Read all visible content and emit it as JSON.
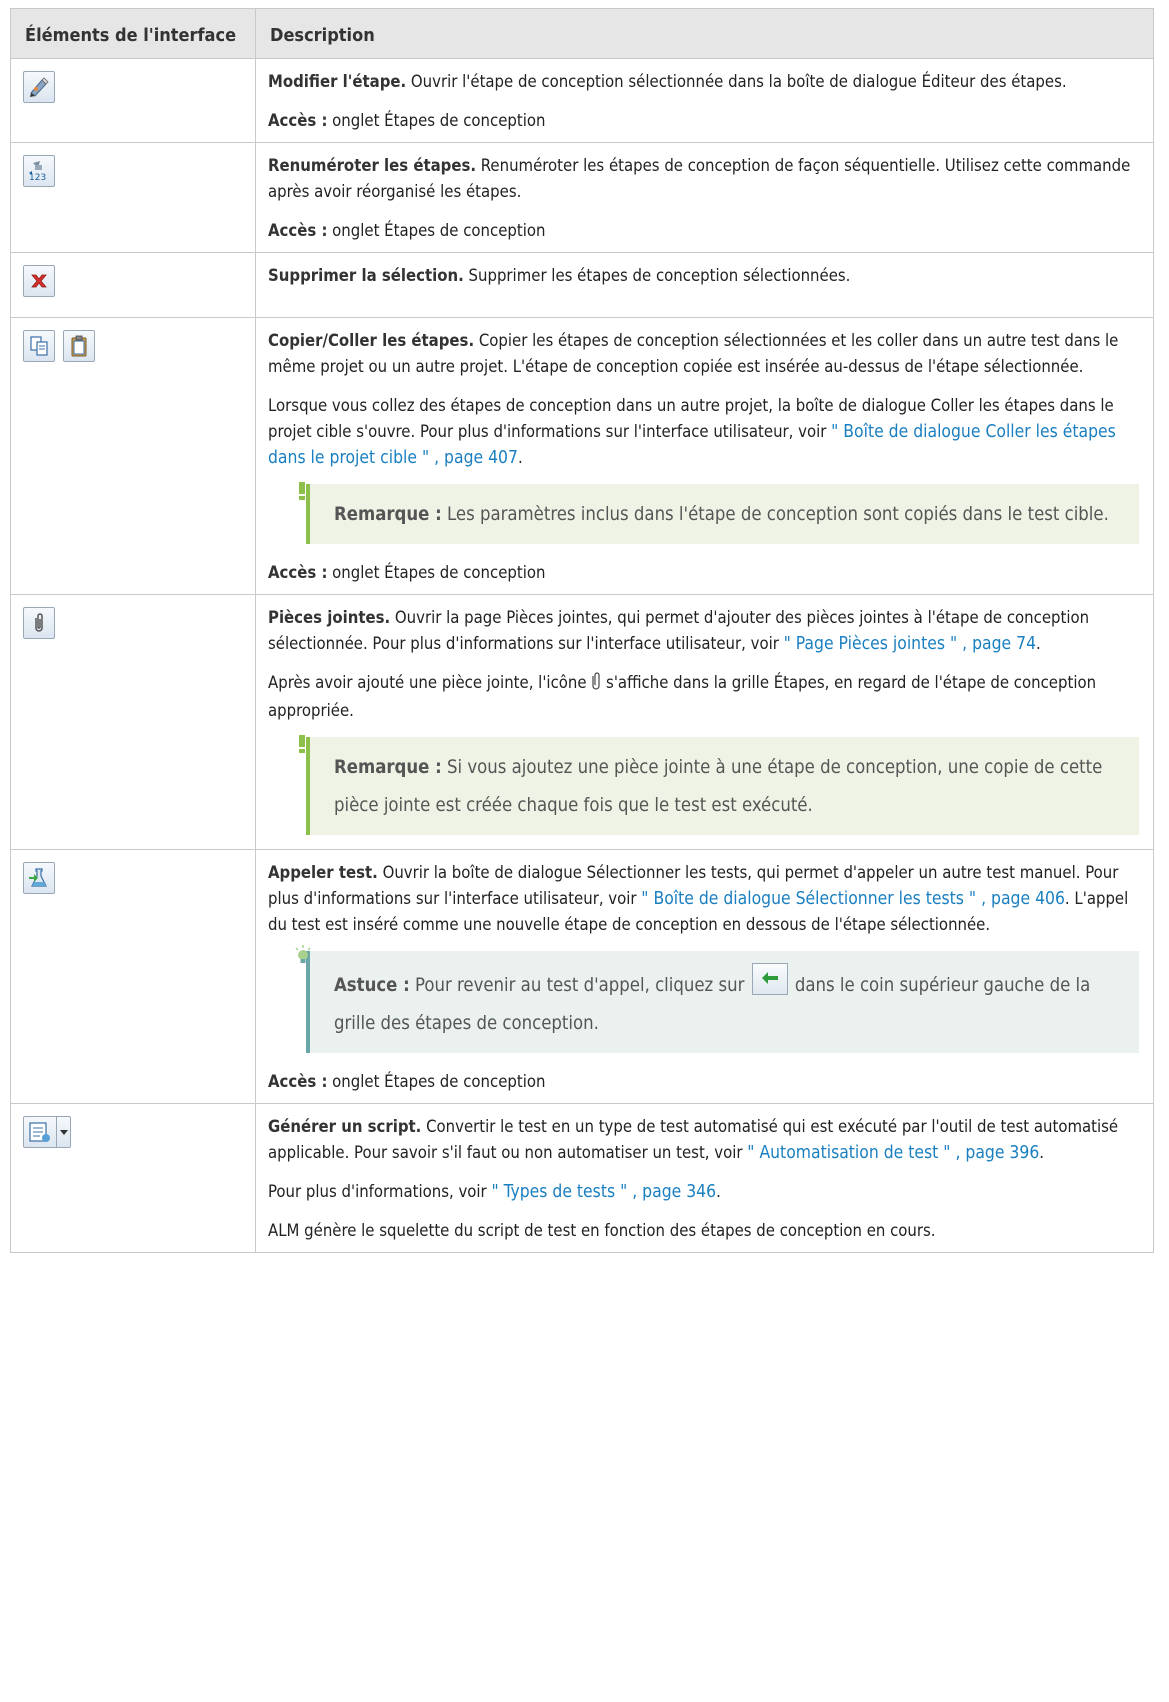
{
  "header": {
    "col1": "Éléments de l'interface",
    "col2": "Description"
  },
  "rows": {
    "r0": {
      "icons": [
        "edit-step-icon"
      ],
      "title": "Modifier l'étape.",
      "text": " Ouvrir l'étape de conception sélectionnée dans la boîte de dialogue Éditeur des étapes.",
      "access_label": "Accès :",
      "access_value": " onglet Étapes de conception"
    },
    "r1": {
      "icons": [
        "renumber-steps-icon"
      ],
      "title": "Renuméroter les étapes.",
      "text": " Renuméroter les étapes de conception de façon séquentielle. Utilisez cette commande après avoir réorganisé les étapes.",
      "access_label": "Accès :",
      "access_value": " onglet Étapes de conception"
    },
    "r2": {
      "icons": [
        "delete-icon"
      ],
      "title": "Supprimer la sélection.",
      "text": " Supprimer les étapes de conception sélectionnées."
    },
    "r3": {
      "icons": [
        "copy-icon",
        "paste-icon"
      ],
      "title": "Copier/Coller les étapes.",
      "text": " Copier les étapes de conception sélectionnées et les coller dans un autre test dans le même projet ou un autre projet. L'étape de conception copiée est insérée au-dessus de l'étape sélectionnée.",
      "p2_text": "Lorsque vous collez des étapes de conception dans un autre projet, la boîte de dialogue Coller les étapes dans le projet cible s'ouvre. Pour plus d'informations sur l'interface utilisateur, voir ",
      "p2_link": "\" Boîte de dialogue Coller les étapes dans le projet cible \" , page 407",
      "p2_end": ".",
      "note_label": "Remarque :",
      "note_text": " Les paramètres inclus dans l'étape de conception sont copiés dans le test cible.",
      "access_label": "Accès :",
      "access_value": " onglet Étapes de conception"
    },
    "r4": {
      "icons": [
        "attachment-icon"
      ],
      "title": "Pièces jointes.",
      "text": " Ouvrir la page Pièces jointes, qui permet d'ajouter des pièces jointes à l'étape de conception sélectionnée. Pour plus d'informations sur l'interface utilisateur, voir ",
      "link": "\" Page Pièces jointes \" , page 74",
      "end": ".",
      "p2_before": "Après avoir ajouté une pièce jointe, l'icône ",
      "p2_after": " s'affiche dans la grille Étapes, en regard de l'étape de conception appropriée.",
      "note_label": "Remarque :",
      "note_text": " Si vous ajoutez une pièce jointe à une étape de conception, une copie de cette pièce jointe est créée chaque fois que le test est exécuté."
    },
    "r5": {
      "icons": [
        "call-test-icon"
      ],
      "title": "Appeler test.",
      "text": " Ouvrir la boîte de dialogue Sélectionner les tests, qui permet d'appeler un autre test manuel. Pour plus d'informations sur l'interface utilisateur, voir ",
      "link": "\" Boîte de dialogue Sélectionner les tests \" , page 406",
      "text2": ". L'appel du test est inséré comme une nouvelle étape de conception en dessous de l'étape sélectionnée.",
      "tip_label": "Astuce :",
      "tip_before": " Pour revenir au test d'appel, cliquez sur ",
      "tip_after": " dans le coin supérieur gauche de la grille des étapes de conception.",
      "access_label": "Accès :",
      "access_value": " onglet Étapes de conception"
    },
    "r6": {
      "icons": [
        "generate-script-icon"
      ],
      "title": "Générer un script.",
      "text": " Convertir le test en un type de test automatisé qui est exécuté par l'outil de test automatisé applicable. Pour savoir s'il faut ou non automatiser un test, voir ",
      "link": "\" Automatisation de test \" , page 396",
      "end": ".",
      "p2_text": "Pour plus d'informations, voir ",
      "p2_link": "\" Types de tests \" , page 346",
      "p2_end": ".",
      "p3_text": "ALM génère le squelette du script de test en fonction des étapes de conception en cours."
    }
  }
}
